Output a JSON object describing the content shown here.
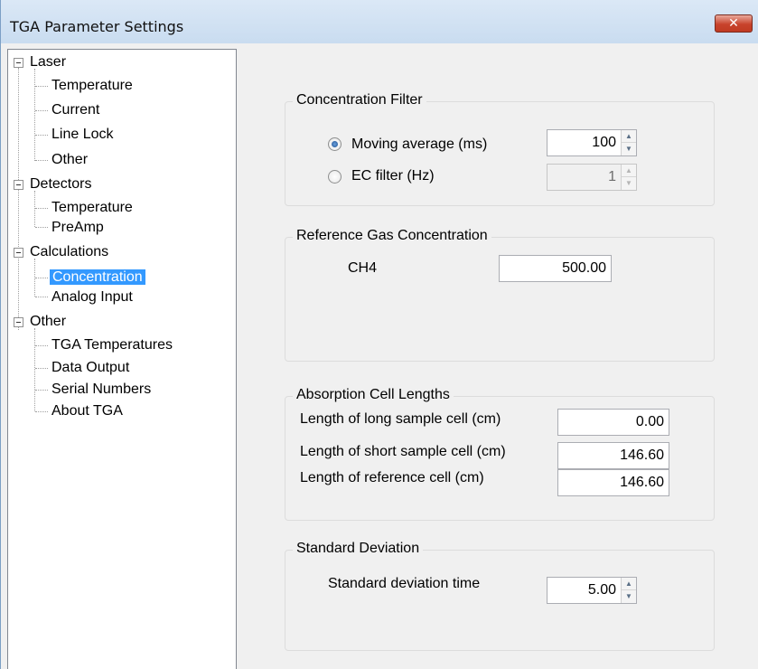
{
  "window": {
    "title": "TGA Parameter Settings",
    "close_label": "✕"
  },
  "tree": {
    "items": [
      {
        "label": "Laser",
        "children": [
          "Temperature",
          "Current",
          "Line Lock",
          "Other"
        ]
      },
      {
        "label": "Detectors",
        "children": [
          "Temperature",
          "PreAmp"
        ]
      },
      {
        "label": "Calculations",
        "children": [
          "Concentration",
          "Analog Input"
        ]
      },
      {
        "label": "Other",
        "children": [
          "TGA Temperatures",
          "Data Output",
          "Serial Numbers",
          "About TGA"
        ]
      }
    ],
    "selected": "Concentration"
  },
  "concentration_filter": {
    "title": "Concentration Filter",
    "moving_average_label": "Moving average (ms)",
    "moving_average_value": "100",
    "moving_average_checked": true,
    "ec_filter_label": "EC filter (Hz)",
    "ec_filter_value": "1",
    "ec_filter_checked": false
  },
  "reference_gas": {
    "title": "Reference Gas Concentration",
    "gas_label": "CH4",
    "gas_value": "500.00"
  },
  "absorption_cell": {
    "title": "Absorption Cell Lengths",
    "long_label": "Length of long sample cell (cm)",
    "long_value": "0.00",
    "short_label": "Length of short sample cell (cm)",
    "short_value": "146.60",
    "reference_label": "Length of reference cell (cm)",
    "reference_value": "146.60"
  },
  "standard_deviation": {
    "title": "Standard Deviation",
    "time_label": "Standard deviation time",
    "time_value": "5.00"
  }
}
